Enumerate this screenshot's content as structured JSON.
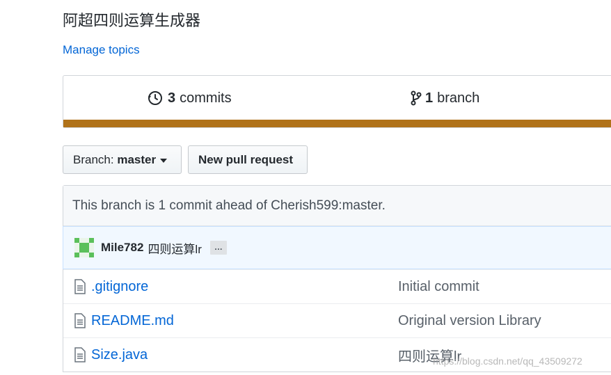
{
  "repo": {
    "description": "阿超四则运算生成器",
    "manage_topics": "Manage topics"
  },
  "summary": {
    "commits_count": "3",
    "commits_label": "commits",
    "branches_count": "1",
    "branches_label": "branch",
    "language_color": "#b07219"
  },
  "toolbar": {
    "branch_label": "Branch:",
    "branch_value": "master",
    "new_pr_label": "New pull request"
  },
  "ahead_notice": "This branch is 1 commit ahead of Cherish599:master.",
  "latest_commit": {
    "author": "Mile782",
    "message": "四则运算lr",
    "ellipsis": "…"
  },
  "files": [
    {
      "name": ".gitignore",
      "message": "Initial commit",
      "icon": "file-icon"
    },
    {
      "name": "README.md",
      "message": "Original version Library",
      "icon": "file-icon"
    },
    {
      "name": "Size.java",
      "message": "四则运算lr",
      "icon": "file-icon"
    }
  ],
  "watermark": "https://blog.csdn.net/qq_43509272"
}
